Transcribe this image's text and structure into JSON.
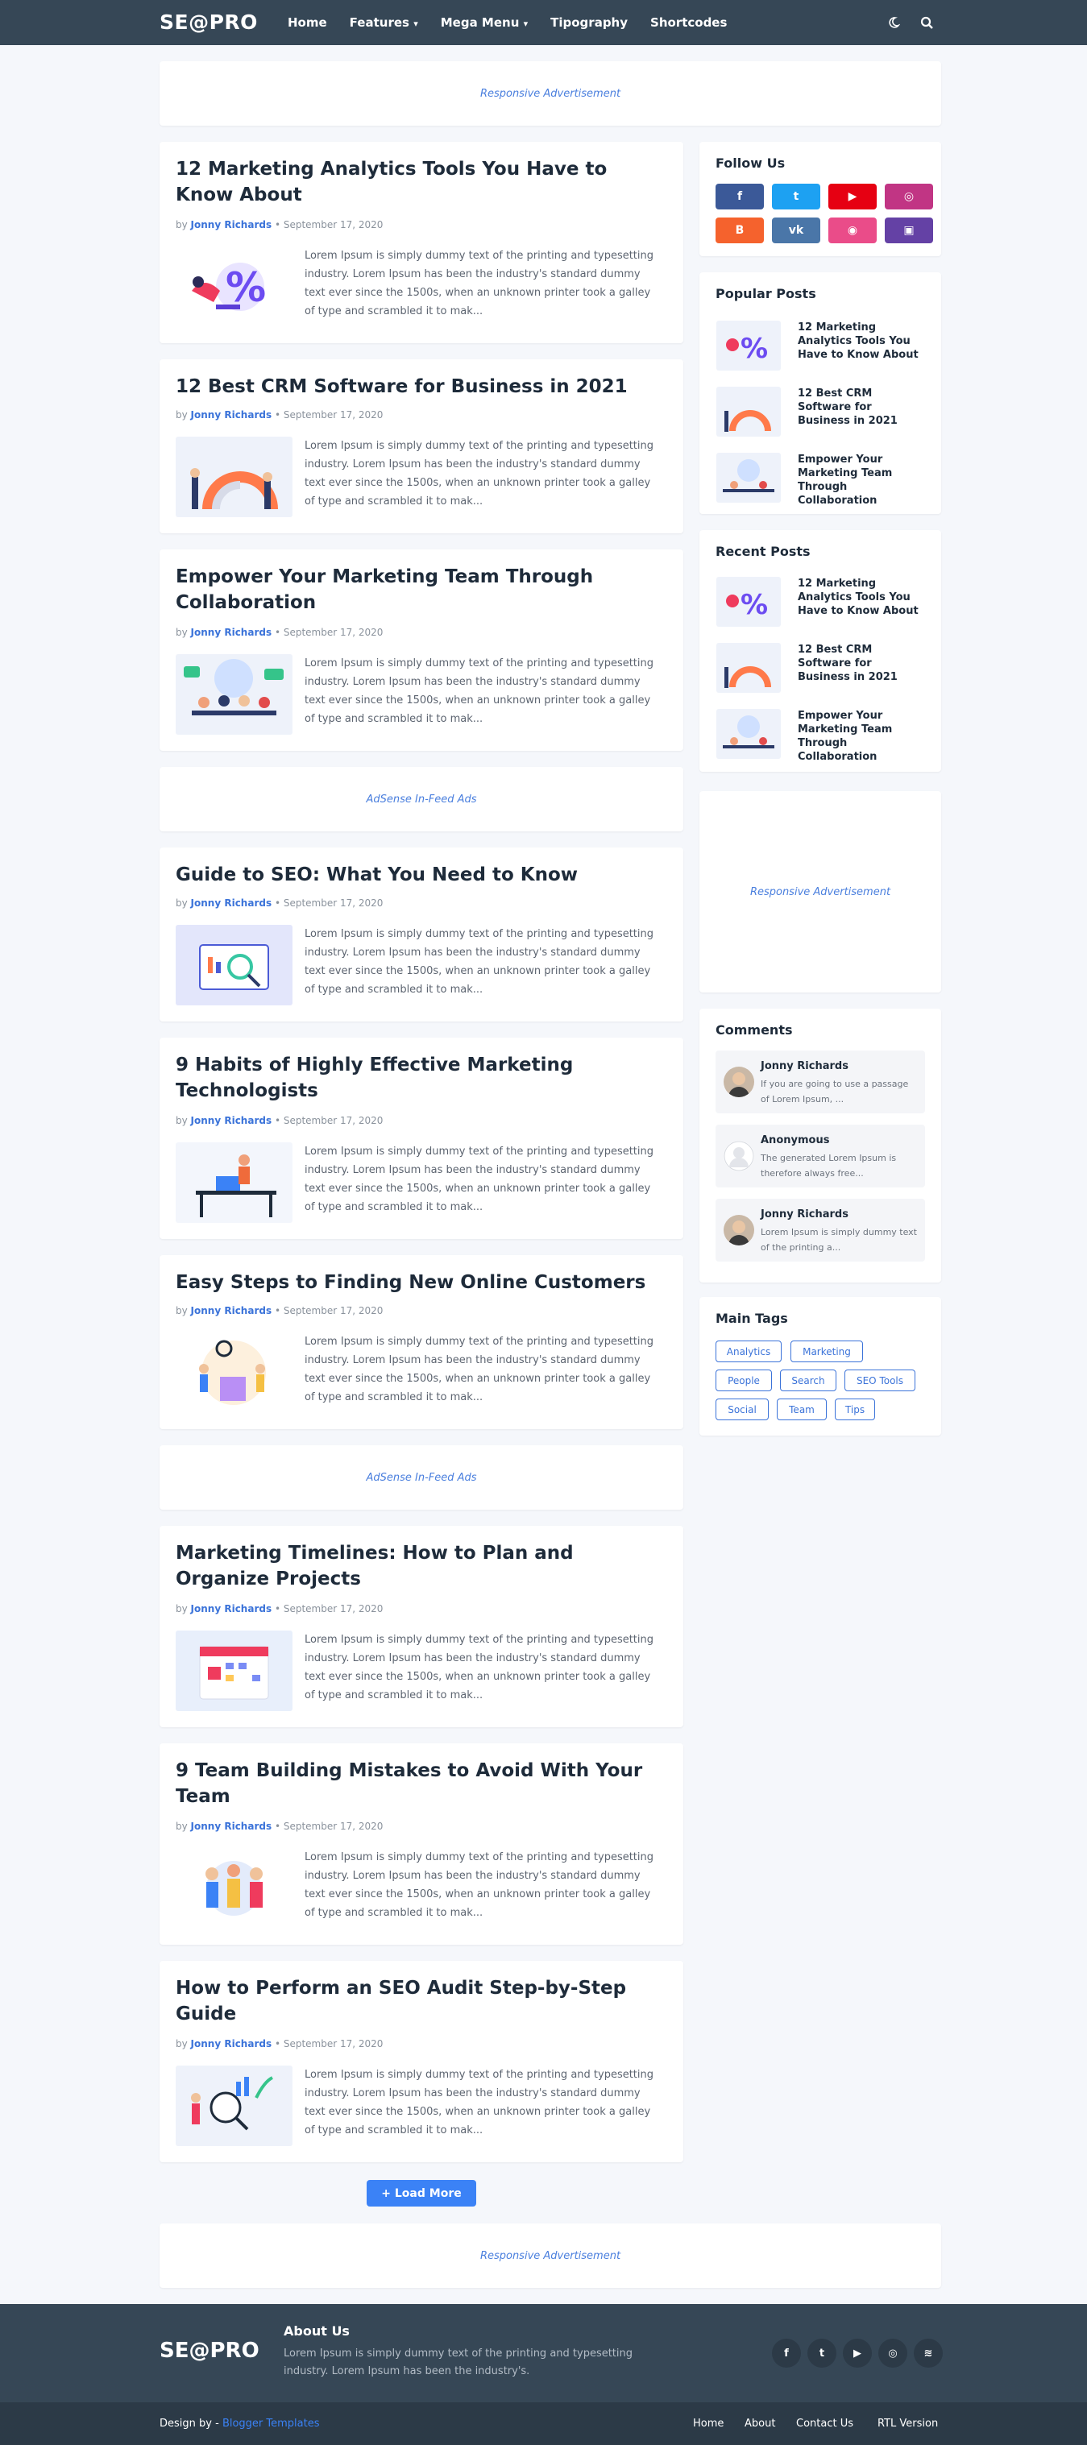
{
  "header": {
    "logo": "SE@PRO",
    "nav": [
      "Home",
      "Features",
      "Mega Menu",
      "Tipography",
      "Shortcodes"
    ],
    "caret": "▾"
  },
  "ads": {
    "responsive": "Responsive Advertisement",
    "infeed": "AdSense In-Feed Ads"
  },
  "posts": [
    {
      "title": "12 Marketing Analytics Tools You Have to Know About",
      "author": "Jonny Richards",
      "date": "September 17, 2020",
      "snippet": "Lorem Ipsum is simply dummy text of the printing and typesetting industry. Lorem Ipsum has been the industry's standard dummy text ever since the 1500s, when an unknown printer took a galley of type and scrambled it to mak..."
    },
    {
      "title": "12 Best CRM Software for Business in 2021",
      "author": "Jonny Richards",
      "date": "September 17, 2020",
      "snippet": "Lorem Ipsum is simply dummy text of the printing and typesetting industry. Lorem Ipsum has been the industry's standard dummy text ever since the 1500s, when an unknown printer took a galley of type and scrambled it to mak..."
    },
    {
      "title": "Empower Your Marketing Team Through Collaboration",
      "author": "Jonny Richards",
      "date": "September 17, 2020",
      "snippet": "Lorem Ipsum is simply dummy text of the printing and typesetting industry. Lorem Ipsum has been the industry's standard dummy text ever since the 1500s, when an unknown printer took a galley of type and scrambled it to mak..."
    },
    {
      "title": "Guide to SEO: What You Need to Know",
      "author": "Jonny Richards",
      "date": "September 17, 2020",
      "snippet": "Lorem Ipsum is simply dummy text of the printing and typesetting industry. Lorem Ipsum has been the industry's standard dummy text ever since the 1500s, when an unknown printer took a galley of type and scrambled it to mak..."
    },
    {
      "title": "9 Habits of Highly Effective Marketing Technologists",
      "author": "Jonny Richards",
      "date": "September 17, 2020",
      "snippet": "Lorem Ipsum is simply dummy text of the printing and typesetting industry. Lorem Ipsum has been the industry's standard dummy text ever since the 1500s, when an unknown printer took a galley of type and scrambled it to mak..."
    },
    {
      "title": "Easy Steps to Finding New Online Customers",
      "author": "Jonny Richards",
      "date": "September 17, 2020",
      "snippet": "Lorem Ipsum is simply dummy text of the printing and typesetting industry. Lorem Ipsum has been the industry's standard dummy text ever since the 1500s, when an unknown printer took a galley of type and scrambled it to mak..."
    },
    {
      "title": "Marketing Timelines: How to Plan and Organize Projects",
      "author": "Jonny Richards",
      "date": "September 17, 2020",
      "snippet": "Lorem Ipsum is simply dummy text of the printing and typesetting industry. Lorem Ipsum has been the industry's standard dummy text ever since the 1500s, when an unknown printer took a galley of type and scrambled it to mak..."
    },
    {
      "title": "9 Team Building Mistakes to Avoid With Your Team",
      "author": "Jonny Richards",
      "date": "September 17, 2020",
      "snippet": "Lorem Ipsum is simply dummy text of the printing and typesetting industry. Lorem Ipsum has been the industry's standard dummy text ever since the 1500s, when an unknown printer took a galley of type and scrambled it to mak..."
    },
    {
      "title": "How to Perform an SEO Audit Step-by-Step Guide",
      "author": "Jonny Richards",
      "date": "September 17, 2020",
      "snippet": "Lorem Ipsum is simply dummy text of the printing and typesetting industry. Lorem Ipsum has been the industry's standard dummy text ever since the 1500s, when an unknown printer took a galley of type and scrambled it to mak..."
    }
  ],
  "meta": {
    "by": "by",
    "sep": "•"
  },
  "load_more": "+ Load More",
  "sidebar": {
    "follow_title": "Follow Us",
    "social": [
      {
        "icon": "facebook-icon",
        "glyph": "f",
        "color": "#3b5998"
      },
      {
        "icon": "twitter-icon",
        "glyph": "t",
        "color": "#1da1f2"
      },
      {
        "icon": "youtube-icon",
        "glyph": "▶",
        "color": "#e60012"
      },
      {
        "icon": "instagram-icon",
        "glyph": "◎",
        "color": "#c13584"
      },
      {
        "icon": "blogger-icon",
        "glyph": "B",
        "color": "#f5622d"
      },
      {
        "icon": "vk-icon",
        "glyph": "vk",
        "color": "#4a76a8"
      },
      {
        "icon": "dribbble-icon",
        "glyph": "◉",
        "color": "#ea4c89"
      },
      {
        "icon": "twitch-icon",
        "glyph": "▣",
        "color": "#6441a5"
      }
    ],
    "popular_title": "Popular Posts",
    "popular": [
      "12 Marketing Analytics Tools You Have to Know About",
      "12 Best CRM Software for Business in 2021",
      "Empower Your Marketing Team Through Collaboration"
    ],
    "recent_title": "Recent Posts",
    "recent": [
      "12 Marketing Analytics Tools You Have to Know About",
      "12 Best CRM Software for Business in 2021",
      "Empower Your Marketing Team Through Collaboration"
    ],
    "comments_title": "Comments",
    "comments": [
      {
        "name": "Jonny Richards",
        "text": "If you are going to use a passage of Lorem Ipsum, ..."
      },
      {
        "name": "Anonymous",
        "text": "The generated Lorem Ipsum is therefore always free..."
      },
      {
        "name": "Jonny Richards",
        "text": "Lorem Ipsum is simply dummy text of the printing a..."
      }
    ],
    "tags_title": "Main Tags",
    "tags": [
      "Analytics",
      "Marketing",
      "People",
      "Search",
      "SEO Tools",
      "Social",
      "Team",
      "Tips"
    ]
  },
  "footer": {
    "logo": "SE@PRO",
    "about_title": "About Us",
    "about_text": "Lorem Ipsum is simply dummy text of the printing and typesetting industry. Lorem Ipsum has been the industry's.",
    "icons": [
      {
        "icon": "facebook-icon",
        "glyph": "f"
      },
      {
        "icon": "twitter-icon",
        "glyph": "t"
      },
      {
        "icon": "youtube-icon",
        "glyph": "▶"
      },
      {
        "icon": "instagram-icon",
        "glyph": "◎"
      },
      {
        "icon": "rss-icon",
        "glyph": "≋"
      }
    ],
    "design_by": "Design by -",
    "design_link": "Blogger Templates",
    "links": [
      "Home",
      "About",
      "Contact Us",
      "RTL Version"
    ]
  }
}
